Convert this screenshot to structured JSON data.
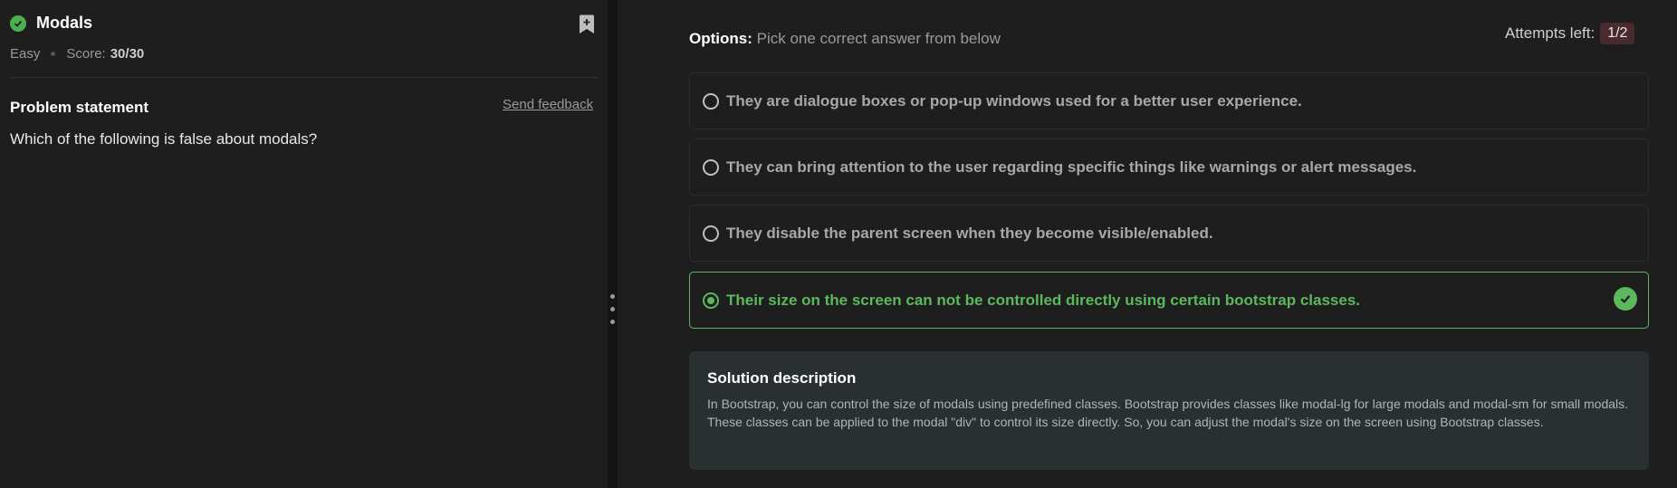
{
  "problem": {
    "title": "Modals",
    "difficulty": "Easy",
    "score_label": "Score:",
    "score_value": "30/30",
    "statement_heading": "Problem statement",
    "send_feedback": "Send feedback",
    "question": "Which of the following is false about modals?"
  },
  "options_panel": {
    "heading": "Options:",
    "subheading": "Pick one correct answer from below",
    "attempts_label": "Attempts left:",
    "attempts_value": "1/2",
    "options": [
      {
        "label": "They are dialogue boxes or pop-up windows used for a better user experience.",
        "selected": false,
        "correct": false
      },
      {
        "label": "They can bring attention to the user regarding specific things like warnings or alert messages.",
        "selected": false,
        "correct": false
      },
      {
        "label": "They disable the parent screen when they become visible/enabled.",
        "selected": false,
        "correct": false
      },
      {
        "label": "Their size on the screen can not be controlled directly using certain bootstrap classes.",
        "selected": true,
        "correct": true
      }
    ]
  },
  "solution": {
    "heading": "Solution description",
    "text": "In Bootstrap, you can control the size of modals using predefined classes. Bootstrap provides classes like modal-lg for large modals and modal-sm for small modals. These classes can be applied to the modal \"div\" to control its size directly. So, you can adjust the modal's size on the screen using Bootstrap classes."
  },
  "icons": {
    "solved": "check-circle-icon",
    "bookmark": "bookmark-add-icon",
    "correct": "check-circle-icon",
    "splitter": "drag-handle-icon"
  },
  "colors": {
    "success": "#5cb85c",
    "background": "#1e1e1e",
    "solution_bg": "#2a3032",
    "attempts_badge": "#4a2a2e"
  }
}
